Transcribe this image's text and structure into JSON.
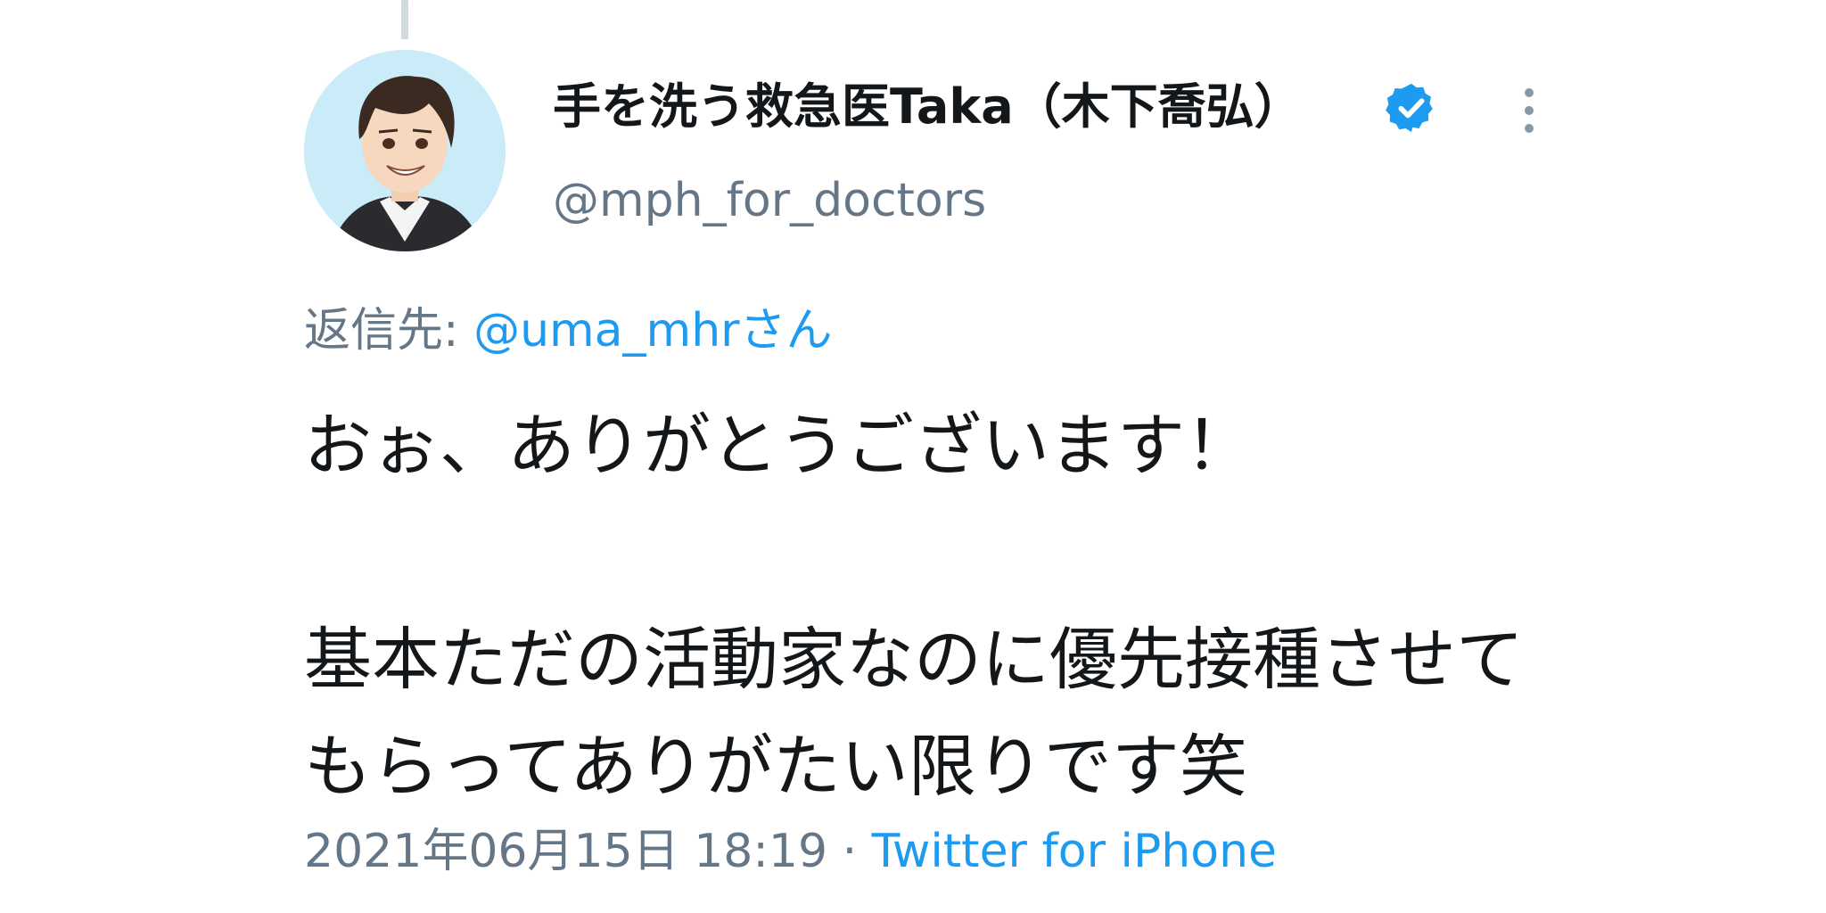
{
  "tweet": {
    "author": {
      "display_name": "手を洗う救急医Taka（木下喬弘）",
      "handle": "@mph_for_doctors",
      "verified": true,
      "avatar_icon": "cartoon-doctor-avatar"
    },
    "reply": {
      "label": "返信先: ",
      "mention": "@uma_mhrさん"
    },
    "text": "おぉ、ありがとうございます！\n\n基本ただの活動家なのに優先接種させてもらってありがたい限りです笑",
    "timestamp": "2021年06月15日 18:19",
    "separator": " · ",
    "source": "Twitter for iPhone"
  },
  "icons": {
    "verified": "verified-badge-icon",
    "more": "more-options-icon"
  },
  "colors": {
    "link": "#1d9bf0",
    "secondary_text": "#657786",
    "primary_text": "#14171a",
    "avatar_bg": "#c9ecf8"
  }
}
